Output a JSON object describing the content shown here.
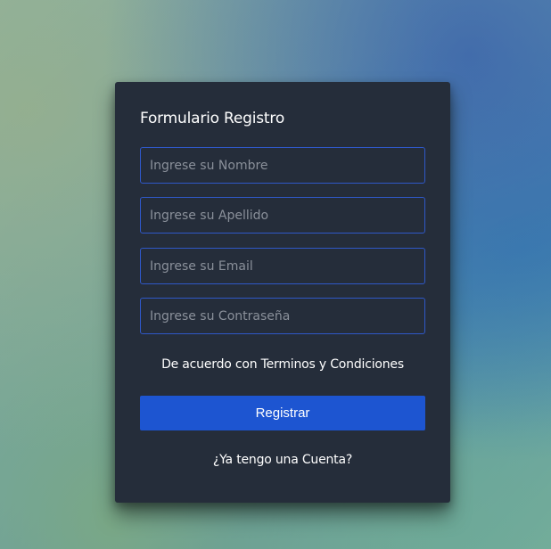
{
  "form": {
    "title": "Formulario Registro",
    "fields": [
      {
        "placeholder": "Ingrese su Nombre",
        "value": ""
      },
      {
        "placeholder": "Ingrese su Apellido",
        "value": ""
      },
      {
        "placeholder": "Ingrese su Email",
        "value": ""
      },
      {
        "placeholder": "Ingrese su Contraseña",
        "value": ""
      }
    ],
    "terms_label": "De acuerdo con Terminos y Condiciones",
    "submit_label": "Registrar",
    "account_link": "¿Ya tengo una Cuenta?"
  },
  "colors": {
    "card_background": "#252d3a",
    "field_border": "#2f58c8",
    "button_background": "#1d55d1",
    "text": "#ffffff",
    "placeholder": "#8a909a"
  }
}
